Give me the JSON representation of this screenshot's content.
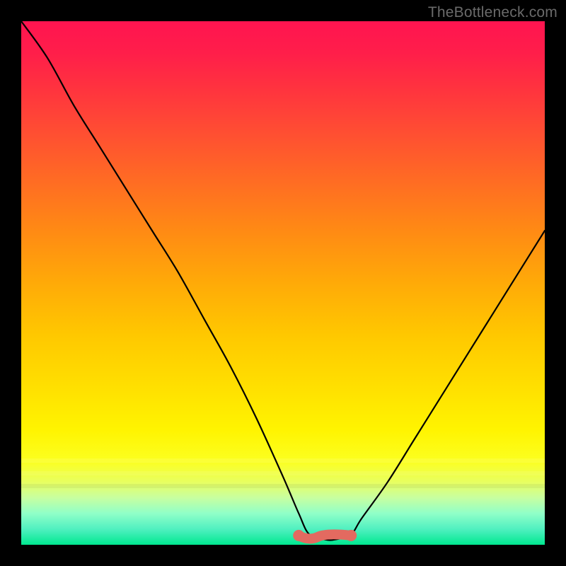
{
  "watermark": "TheBottleneck.com",
  "colors": {
    "background": "#000000",
    "curve": "#000000",
    "marker": "#e36a60",
    "gradient_top": "#ff1450",
    "gradient_bottom": "#00e890"
  },
  "chart_data": {
    "type": "line",
    "title": "",
    "xlabel": "",
    "ylabel": "",
    "xlim": [
      0,
      100
    ],
    "ylim": [
      0,
      100
    ],
    "grid": false,
    "legend": false,
    "axes_visible": false,
    "note": "V-shaped bottleneck curve; y ≈ 100 means severe bottleneck (red/top), y ≈ 0 means balanced (green/bottom). Minimum plateau near x ≈ 55–63.",
    "series": [
      {
        "name": "bottleneck-curve",
        "color": "#000000",
        "x": [
          0,
          5,
          10,
          15,
          20,
          25,
          30,
          35,
          40,
          45,
          50,
          53,
          55,
          58,
          60,
          63,
          65,
          70,
          75,
          80,
          85,
          90,
          95,
          100
        ],
        "y": [
          100,
          93,
          84,
          76,
          68,
          60,
          52,
          43,
          34,
          24,
          13,
          6,
          2,
          1,
          1,
          2,
          5,
          12,
          20,
          28,
          36,
          44,
          52,
          60
        ]
      }
    ],
    "flat_region_marker": {
      "color": "#e36a60",
      "x_start": 53,
      "x_end": 63,
      "y": 1.5
    }
  }
}
